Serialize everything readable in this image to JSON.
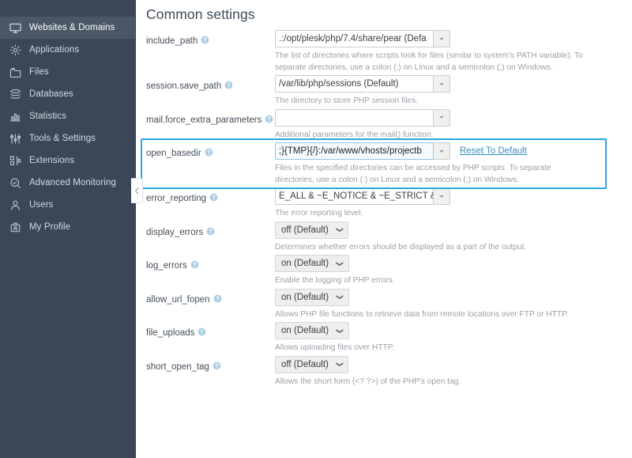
{
  "sidebar": {
    "items": [
      {
        "label": "Websites & Domains",
        "icon": "monitor-icon",
        "active": true
      },
      {
        "label": "Applications",
        "icon": "gear-icon",
        "active": false
      },
      {
        "label": "Files",
        "icon": "folder-icon",
        "active": false
      },
      {
        "label": "Databases",
        "icon": "database-icon",
        "active": false
      },
      {
        "label": "Statistics",
        "icon": "bar-chart-icon",
        "active": false
      },
      {
        "label": "Tools & Settings",
        "icon": "sliders-icon",
        "active": false
      },
      {
        "label": "Extensions",
        "icon": "extensions-icon",
        "active": false
      },
      {
        "label": "Advanced Monitoring",
        "icon": "magnifier-icon",
        "active": false
      },
      {
        "label": "Users",
        "icon": "user-icon",
        "active": false
      },
      {
        "label": "My Profile",
        "icon": "id-badge-icon",
        "active": false
      }
    ],
    "collapse_icon": "chevron-left-icon"
  },
  "main": {
    "title": "Common settings",
    "reset_to_default": "Reset To Default",
    "settings": [
      {
        "name": "include_path",
        "control": "text",
        "value": ".:/opt/plesk/php/7.4/share/pear (Defa",
        "description": "The list of directories where scripts look for files (similar to system's PATH variable). To separate directories, use a colon (:) on Linux and a semicolon (;) on Windows."
      },
      {
        "name": "session.save_path",
        "control": "text",
        "value": "/var/lib/php/sessions (Default)",
        "description": "The directory to store PHP session files."
      },
      {
        "name": "mail.force_extra_parameters",
        "control": "text",
        "value": "",
        "description": "Additional parameters for the mail() function."
      },
      {
        "name": "open_basedir",
        "control": "text",
        "value": ";}{TMP}{/}:/var/www/vhosts/projectb",
        "description": "Files in the specified directories can be accessed by PHP scripts. To separate directories, use a colon (:) on Linux and a semicolon (;) on Windows.",
        "highlighted": true,
        "has_reset": true
      },
      {
        "name": "error_reporting",
        "control": "text",
        "value": "E_ALL & ~E_NOTICE & ~E_STRICT & ~E",
        "description": "The error reporting level."
      },
      {
        "name": "display_errors",
        "control": "select",
        "value": "off (Default)",
        "description": "Determines whether errors should be displayed as a part of the output."
      },
      {
        "name": "log_errors",
        "control": "select",
        "value": "on (Default)",
        "description": "Enable the logging of PHP errors."
      },
      {
        "name": "allow_url_fopen",
        "control": "select",
        "value": "on (Default)",
        "description": "Allows PHP file functions to retrieve data from remote locations over FTP or HTTP."
      },
      {
        "name": "file_uploads",
        "control": "select",
        "value": "on (Default)",
        "description": "Allows uploading files over HTTP."
      },
      {
        "name": "short_open_tag",
        "control": "select",
        "value": "off (Default)",
        "description": "Allows the short form (<? ?>) of the PHP's open tag."
      }
    ]
  },
  "colors": {
    "sidebar_bg": "#3b4756",
    "sidebar_active": "#4a5766",
    "highlight_border": "#29a8df",
    "link": "#3c8dbc",
    "help_icon": "#8fbcd4"
  }
}
